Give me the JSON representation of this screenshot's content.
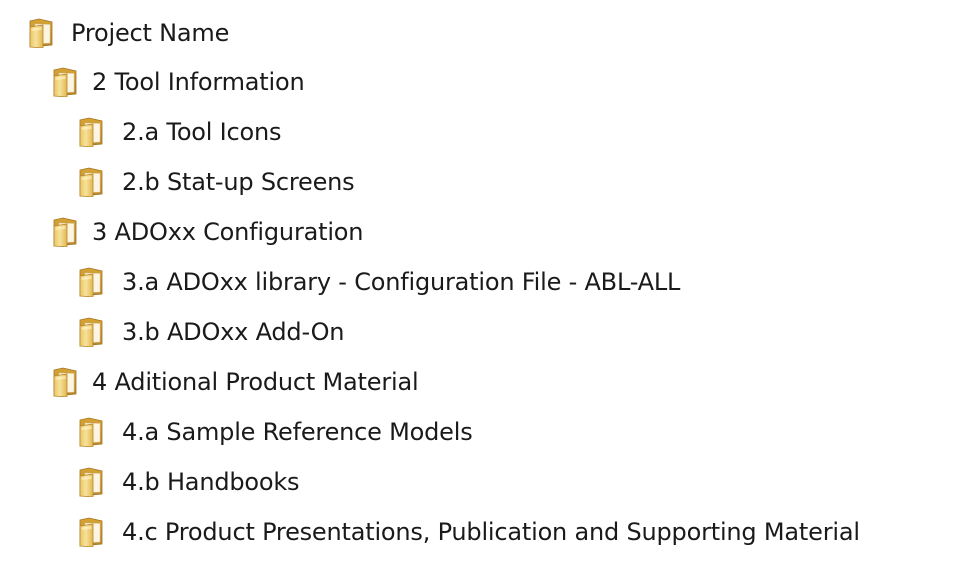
{
  "tree": {
    "items": [
      {
        "label": "Project Name",
        "level": 0,
        "icon": "folder-icon"
      },
      {
        "label": "2 Tool Information",
        "level": 1,
        "icon": "folder-icon"
      },
      {
        "label": "2.a Tool Icons",
        "level": 2,
        "icon": "folder-icon"
      },
      {
        "label": "2.b Stat-up Screens",
        "level": 2,
        "icon": "folder-icon"
      },
      {
        "label": "3 ADOxx Configuration",
        "level": 1,
        "icon": "folder-icon"
      },
      {
        "label": "3.a ADOxx library - Configuration File - ABL-ALL",
        "level": 2,
        "icon": "folder-icon"
      },
      {
        "label": "3.b ADOxx Add-On",
        "level": 2,
        "icon": "folder-icon"
      },
      {
        "label": "4 Aditional Product Material",
        "level": 1,
        "icon": "folder-icon"
      },
      {
        "label": "4.a Sample Reference Models",
        "level": 2,
        "icon": "folder-icon"
      },
      {
        "label": "4.b Handbooks",
        "level": 2,
        "icon": "folder-icon"
      },
      {
        "label": "4.c Product Presentations, Publication and Supporting Material",
        "level": 2,
        "icon": "folder-icon"
      }
    ]
  },
  "colors": {
    "folder_front": "#f2d37a",
    "folder_back": "#d9a938",
    "folder_edge": "#b8862a",
    "text": "#1a1a1a"
  }
}
